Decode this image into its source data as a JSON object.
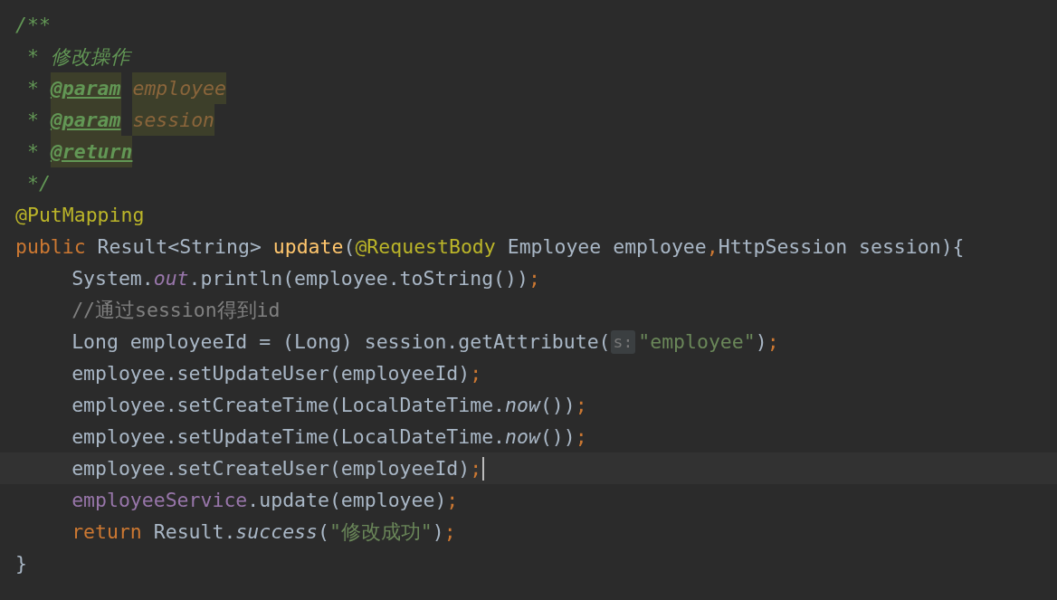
{
  "editor": {
    "lines": [
      {
        "current": false,
        "indented": false,
        "tokens": [
          {
            "text": "/**",
            "kind": "doc"
          }
        ]
      },
      {
        "current": false,
        "indented": false,
        "tokens": [
          {
            "text": " * 修改操作",
            "kind": "doc"
          }
        ]
      },
      {
        "current": false,
        "indented": false,
        "tokens": [
          {
            "text": " * ",
            "kind": "doc"
          },
          {
            "text": "@param",
            "kind": "doc-tag"
          },
          {
            "text": "employee",
            "kind": "doc-param"
          }
        ]
      },
      {
        "current": false,
        "indented": false,
        "tokens": [
          {
            "text": " * ",
            "kind": "doc"
          },
          {
            "text": "@param",
            "kind": "doc-tag"
          },
          {
            "text": "session",
            "kind": "doc-param"
          }
        ]
      },
      {
        "current": false,
        "indented": false,
        "tokens": [
          {
            "text": " * ",
            "kind": "doc"
          },
          {
            "text": "@return",
            "kind": "doc-tag"
          }
        ]
      },
      {
        "current": false,
        "indented": false,
        "tokens": [
          {
            "text": " */",
            "kind": "doc"
          }
        ]
      },
      {
        "current": false,
        "indented": false,
        "tokens": [
          {
            "text": "@PutMapping",
            "kind": "annotation"
          }
        ]
      },
      {
        "current": false,
        "indented": false,
        "tokens": [
          {
            "text": "public",
            "kind": "keyword"
          },
          {
            "text": " Result<String> ",
            "kind": "plain"
          },
          {
            "text": "update",
            "kind": "method"
          },
          {
            "text": "(",
            "kind": "plain"
          },
          {
            "text": "@RequestBody",
            "kind": "annotation"
          },
          {
            "text": " Employee employee",
            "kind": "plain"
          },
          {
            "text": ",",
            "kind": "punct"
          },
          {
            "text": "HttpSession session){",
            "kind": "plain"
          }
        ]
      },
      {
        "current": false,
        "indented": true,
        "tokens": [
          {
            "text": "System.",
            "kind": "plain"
          },
          {
            "text": "out",
            "kind": "static-field"
          },
          {
            "text": ".println(employee.toString())",
            "kind": "plain"
          },
          {
            "text": ";",
            "kind": "punct"
          }
        ]
      },
      {
        "current": false,
        "indented": true,
        "tokens": [
          {
            "text": "//通过session得到id",
            "kind": "line-comment"
          }
        ]
      },
      {
        "current": false,
        "indented": true,
        "tokens": [
          {
            "text": "Long employeeId = (Long) session.getAttribute(",
            "kind": "plain"
          },
          {
            "text": "s:",
            "kind": "hint"
          },
          {
            "text": "\"employee\"",
            "kind": "string"
          },
          {
            "text": ")",
            "kind": "plain"
          },
          {
            "text": ";",
            "kind": "punct"
          }
        ]
      },
      {
        "current": false,
        "indented": true,
        "tokens": [
          {
            "text": "employee.setUpdateUser(employeeId)",
            "kind": "plain"
          },
          {
            "text": ";",
            "kind": "punct"
          }
        ]
      },
      {
        "current": false,
        "indented": true,
        "tokens": [
          {
            "text": "employee.setCreateTime(LocalDateTime.",
            "kind": "plain"
          },
          {
            "text": "now",
            "kind": "static-call"
          },
          {
            "text": "())",
            "kind": "plain"
          },
          {
            "text": ";",
            "kind": "punct"
          }
        ]
      },
      {
        "current": false,
        "indented": true,
        "tokens": [
          {
            "text": "employee.setUpdateTime(LocalDateTime.",
            "kind": "plain"
          },
          {
            "text": "now",
            "kind": "static-call"
          },
          {
            "text": "())",
            "kind": "plain"
          },
          {
            "text": ";",
            "kind": "punct"
          }
        ]
      },
      {
        "current": true,
        "indented": true,
        "tokens": [
          {
            "text": "employee.setCreateUser(employeeId)",
            "kind": "plain"
          },
          {
            "text": ";",
            "kind": "punct"
          }
        ]
      },
      {
        "current": false,
        "indented": true,
        "tokens": [
          {
            "text": "employeeService",
            "kind": "field"
          },
          {
            "text": ".update(employee)",
            "kind": "plain"
          },
          {
            "text": ";",
            "kind": "punct"
          }
        ]
      },
      {
        "current": false,
        "indented": true,
        "tokens": [
          {
            "text": "return",
            "kind": "keyword"
          },
          {
            "text": " Result.",
            "kind": "plain"
          },
          {
            "text": "success",
            "kind": "static-call"
          },
          {
            "text": "(",
            "kind": "plain"
          },
          {
            "text": "\"修改成功\"",
            "kind": "string"
          },
          {
            "text": ")",
            "kind": "plain"
          },
          {
            "text": ";",
            "kind": "punct"
          }
        ]
      },
      {
        "current": false,
        "indented": false,
        "tokens": [
          {
            "text": "}",
            "kind": "plain"
          }
        ]
      }
    ]
  }
}
